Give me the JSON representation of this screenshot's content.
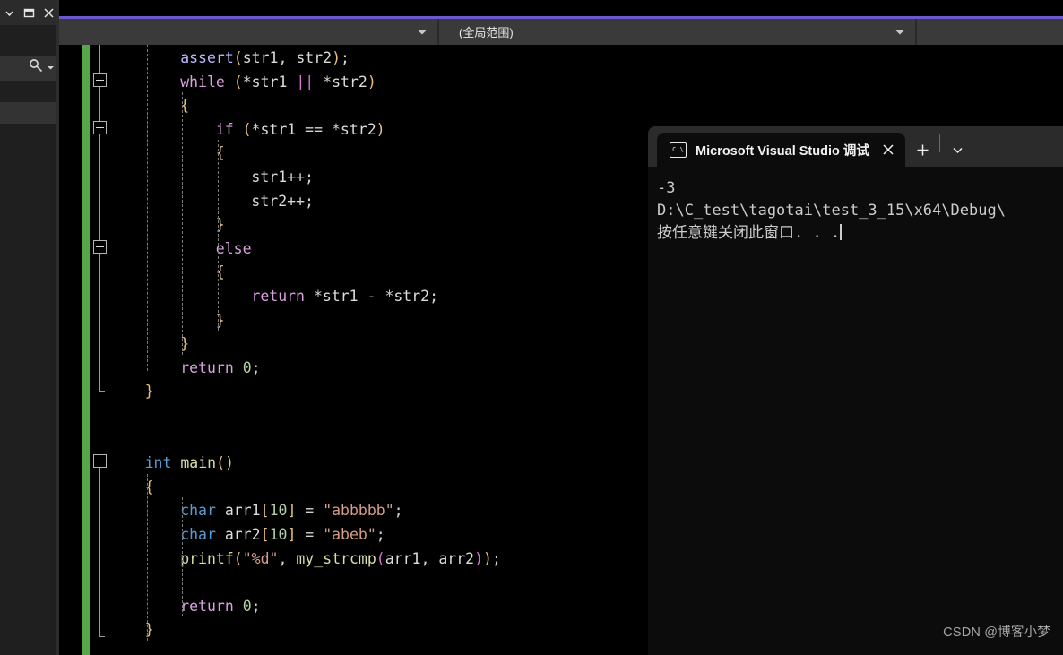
{
  "window": {
    "caption_buttons": [
      {
        "name": "dropdown-caret",
        "glyph": "▾"
      },
      {
        "name": "restore",
        "glyph": "▭"
      },
      {
        "name": "close",
        "glyph": "✕"
      }
    ],
    "search_icon": "search-key-icon"
  },
  "navbar": {
    "combo_left_value": "",
    "combo_right_value": "(全局范围)",
    "accent_color": "#6a5acd",
    "background": "#3a3a3a"
  },
  "editor": {
    "background": "#000000",
    "change_bar_color": "#57a64a",
    "lines": [
      {
        "indent": 2,
        "tokens": [
          {
            "t": "assert",
            "c": "mac"
          },
          {
            "t": "(",
            "c": "brk1"
          },
          {
            "t": "str1",
            "c": "id"
          },
          {
            "t": ", ",
            "c": "pun"
          },
          {
            "t": "str2",
            "c": "id"
          },
          {
            "t": ")",
            "c": "brk1"
          },
          {
            "t": ";",
            "c": "pun"
          }
        ]
      },
      {
        "indent": 2,
        "tokens": [
          {
            "t": "while",
            "c": "kw"
          },
          {
            "t": " ",
            "c": "pun"
          },
          {
            "t": "(",
            "c": "brk1"
          },
          {
            "t": "*",
            "c": "op"
          },
          {
            "t": "str1",
            "c": "id"
          },
          {
            "t": " ",
            "c": "pun"
          },
          {
            "t": "||",
            "c": "brk2"
          },
          {
            "t": " ",
            "c": "pun"
          },
          {
            "t": "*",
            "c": "op"
          },
          {
            "t": "str2",
            "c": "id"
          },
          {
            "t": ")",
            "c": "brk1"
          }
        ]
      },
      {
        "indent": 2,
        "tokens": [
          {
            "t": "{",
            "c": "brk1"
          }
        ]
      },
      {
        "indent": 3,
        "tokens": [
          {
            "t": "if",
            "c": "kw"
          },
          {
            "t": " ",
            "c": "pun"
          },
          {
            "t": "(",
            "c": "brk1"
          },
          {
            "t": "*",
            "c": "op"
          },
          {
            "t": "str1",
            "c": "id"
          },
          {
            "t": " == ",
            "c": "op"
          },
          {
            "t": "*",
            "c": "op"
          },
          {
            "t": "str2",
            "c": "id"
          },
          {
            "t": ")",
            "c": "brk1"
          }
        ]
      },
      {
        "indent": 3,
        "tokens": [
          {
            "t": "{",
            "c": "brk1"
          }
        ]
      },
      {
        "indent": 4,
        "tokens": [
          {
            "t": "str1",
            "c": "id"
          },
          {
            "t": "++;",
            "c": "op"
          }
        ]
      },
      {
        "indent": 4,
        "tokens": [
          {
            "t": "str2",
            "c": "id"
          },
          {
            "t": "++;",
            "c": "op"
          }
        ]
      },
      {
        "indent": 3,
        "tokens": [
          {
            "t": "}",
            "c": "brk1"
          }
        ]
      },
      {
        "indent": 3,
        "tokens": [
          {
            "t": "else",
            "c": "kw"
          }
        ]
      },
      {
        "indent": 3,
        "tokens": [
          {
            "t": "{",
            "c": "brk1"
          }
        ]
      },
      {
        "indent": 4,
        "tokens": [
          {
            "t": "return",
            "c": "kw"
          },
          {
            "t": " ",
            "c": "pun"
          },
          {
            "t": "*",
            "c": "op"
          },
          {
            "t": "str1",
            "c": "id"
          },
          {
            "t": " - ",
            "c": "op"
          },
          {
            "t": "*",
            "c": "op"
          },
          {
            "t": "str2",
            "c": "id"
          },
          {
            "t": ";",
            "c": "pun"
          }
        ]
      },
      {
        "indent": 3,
        "tokens": [
          {
            "t": "}",
            "c": "brk1"
          }
        ]
      },
      {
        "indent": 2,
        "tokens": [
          {
            "t": "}",
            "c": "brk1"
          }
        ]
      },
      {
        "indent": 2,
        "tokens": [
          {
            "t": "return",
            "c": "kw"
          },
          {
            "t": " ",
            "c": "pun"
          },
          {
            "t": "0",
            "c": "num"
          },
          {
            "t": ";",
            "c": "pun"
          }
        ]
      },
      {
        "indent": 1,
        "tokens": [
          {
            "t": "}",
            "c": "brk1"
          }
        ]
      },
      {
        "indent": 0,
        "tokens": []
      },
      {
        "indent": 0,
        "tokens": []
      },
      {
        "indent": 1,
        "tokens": [
          {
            "t": "int",
            "c": "type"
          },
          {
            "t": " ",
            "c": "pun"
          },
          {
            "t": "main",
            "c": "fn"
          },
          {
            "t": "()",
            "c": "brk1"
          }
        ]
      },
      {
        "indent": 1,
        "tokens": [
          {
            "t": "{",
            "c": "brk1"
          }
        ]
      },
      {
        "indent": 2,
        "tokens": [
          {
            "t": "char",
            "c": "type"
          },
          {
            "t": " ",
            "c": "pun"
          },
          {
            "t": "arr1",
            "c": "id"
          },
          {
            "t": "[",
            "c": "brk1"
          },
          {
            "t": "10",
            "c": "num"
          },
          {
            "t": "]",
            "c": "brk1"
          },
          {
            "t": " = ",
            "c": "op"
          },
          {
            "t": "\"abbbbb\"",
            "c": "str"
          },
          {
            "t": ";",
            "c": "pun"
          }
        ]
      },
      {
        "indent": 2,
        "tokens": [
          {
            "t": "char",
            "c": "type"
          },
          {
            "t": " ",
            "c": "pun"
          },
          {
            "t": "arr2",
            "c": "id"
          },
          {
            "t": "[",
            "c": "brk1"
          },
          {
            "t": "10",
            "c": "num"
          },
          {
            "t": "]",
            "c": "brk1"
          },
          {
            "t": " = ",
            "c": "op"
          },
          {
            "t": "\"abeb\"",
            "c": "str"
          },
          {
            "t": ";",
            "c": "pun"
          }
        ]
      },
      {
        "indent": 2,
        "tokens": [
          {
            "t": "printf",
            "c": "fn"
          },
          {
            "t": "(",
            "c": "brk1"
          },
          {
            "t": "\"%d\"",
            "c": "str"
          },
          {
            "t": ", ",
            "c": "pun"
          },
          {
            "t": "my_strcmp",
            "c": "fn"
          },
          {
            "t": "(",
            "c": "brk2"
          },
          {
            "t": "arr1",
            "c": "id"
          },
          {
            "t": ", ",
            "c": "pun"
          },
          {
            "t": "arr2",
            "c": "id"
          },
          {
            "t": ")",
            "c": "brk2"
          },
          {
            "t": ")",
            "c": "brk1"
          },
          {
            "t": ";",
            "c": "pun"
          }
        ]
      },
      {
        "indent": 0,
        "tokens": []
      },
      {
        "indent": 2,
        "tokens": [
          {
            "t": "return",
            "c": "kw"
          },
          {
            "t": " ",
            "c": "pun"
          },
          {
            "t": "0",
            "c": "num"
          },
          {
            "t": ";",
            "c": "pun"
          }
        ]
      },
      {
        "indent": 1,
        "tokens": [
          {
            "t": "}",
            "c": "brk1"
          }
        ]
      }
    ]
  },
  "console": {
    "tab_title": "Microsoft Visual Studio 调试控制台",
    "tab_icon": "cmd-terminal-icon",
    "close_glyph": "✕",
    "new_tab_glyph": "+",
    "dropdown_glyph": "⌄",
    "output_lines": [
      "-3",
      "D:\\C_test\\tagotai\\test_3_15\\x64\\Debug\\",
      "按任意键关闭此窗口. . ."
    ]
  },
  "watermark": {
    "text": "CSDN @博客小梦"
  }
}
